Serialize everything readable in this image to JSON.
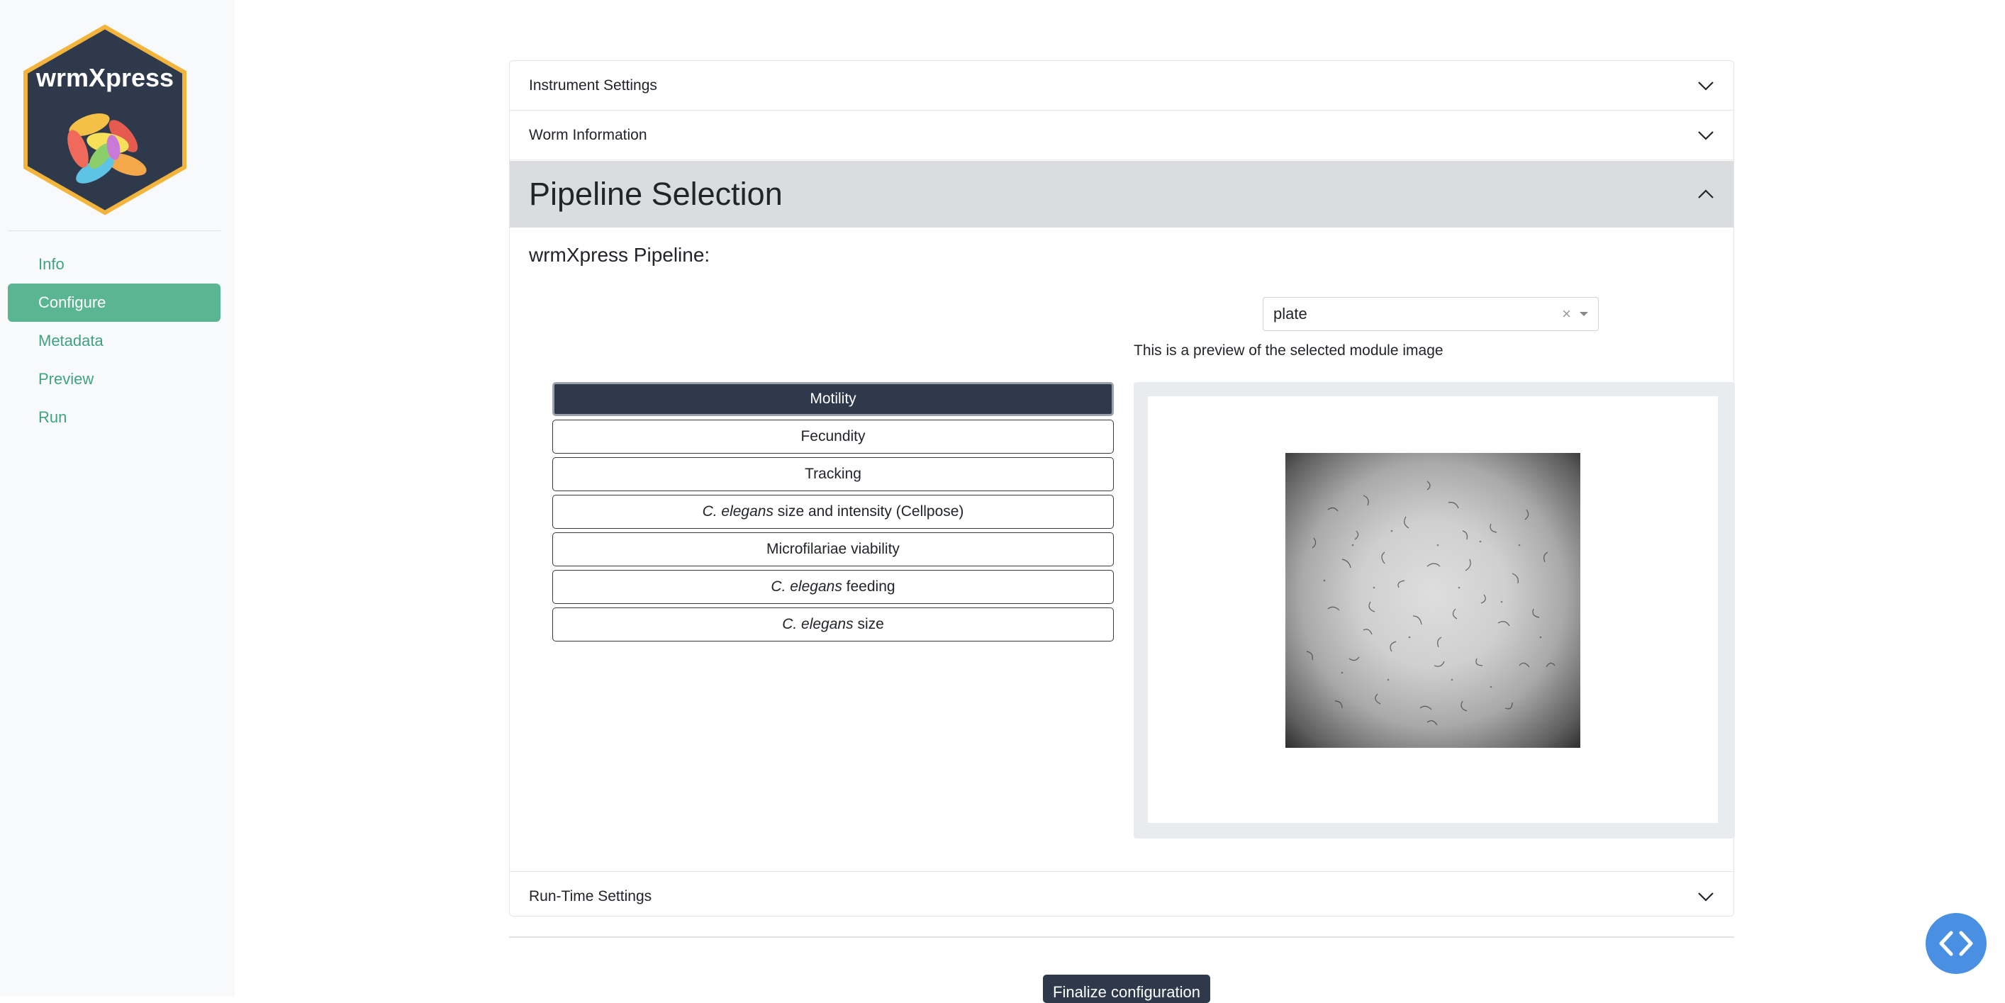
{
  "sidebar": {
    "logo_text": "wrmXpress",
    "items": [
      {
        "label": "Info",
        "active": false
      },
      {
        "label": "Configure",
        "active": true
      },
      {
        "label": "Metadata",
        "active": false
      },
      {
        "label": "Preview",
        "active": false
      },
      {
        "label": "Run",
        "active": false
      }
    ]
  },
  "accordion": {
    "instrument_settings": "Instrument Settings",
    "worm_information": "Worm Information",
    "pipeline_selection": "Pipeline Selection",
    "runtime_settings": "Run-Time Settings"
  },
  "pipeline": {
    "label": "wrmXpress Pipeline:",
    "select_value": "plate",
    "select_clear": "×",
    "preview_caption": "This is a preview of the selected module image",
    "modules": [
      {
        "italic": "",
        "text": "Motility",
        "active": true
      },
      {
        "italic": "",
        "text": "Fecundity",
        "active": false
      },
      {
        "italic": "",
        "text": "Tracking",
        "active": false
      },
      {
        "italic": "C. elegans",
        "text": " size and intensity (Cellpose)",
        "active": false
      },
      {
        "italic": "",
        "text": "Microfilariae viability",
        "active": false
      },
      {
        "italic": "C. elegans",
        "text": " feeding",
        "active": false
      },
      {
        "italic": "C. elegans",
        "text": " size",
        "active": false
      }
    ]
  },
  "footer": {
    "finalize_label": "Finalize configuration"
  },
  "colors": {
    "accent_green": "#5ab592",
    "link_green": "#3fa47e",
    "dark_button": "#2e3a4b",
    "fab_blue": "#4a90e2"
  },
  "icons": {
    "accordion_collapsed": "chevron-down-icon",
    "accordion_expanded": "chevron-up-icon",
    "fab": "code-brackets-icon"
  }
}
